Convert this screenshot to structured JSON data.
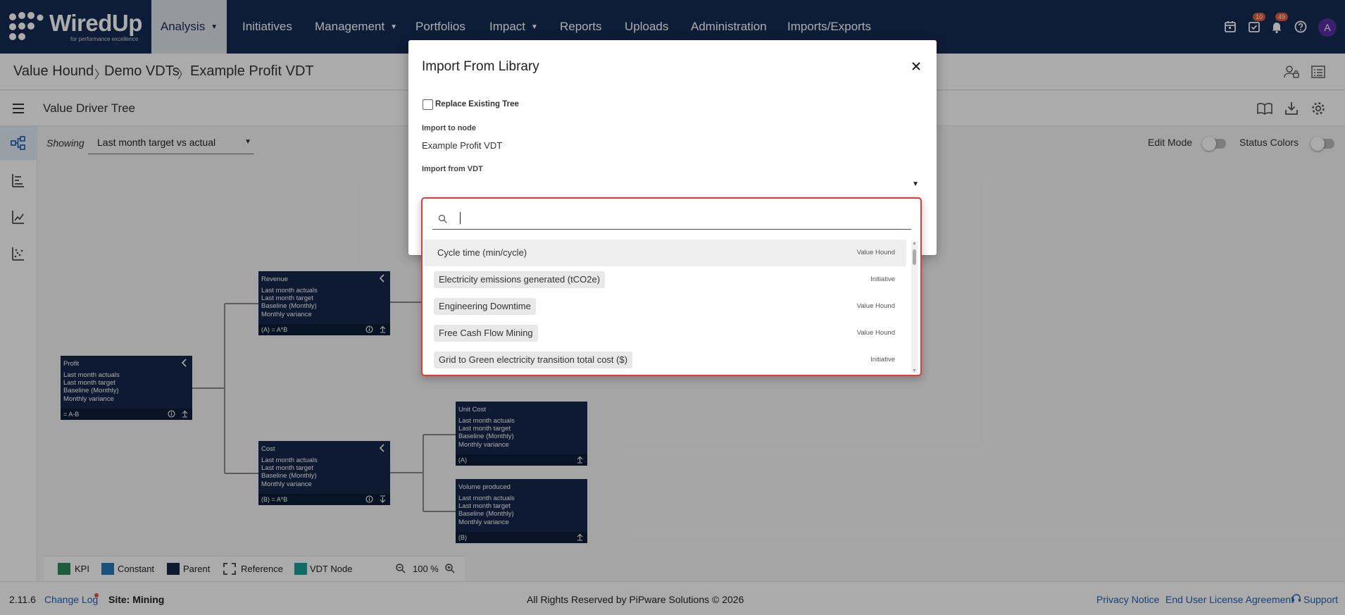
{
  "nav": {
    "logo_text": "WiredUp",
    "logo_tagline": "for performance excellence",
    "items": [
      {
        "label": "Analysis",
        "caret": true,
        "active": true
      },
      {
        "label": "Initiatives",
        "caret": false
      },
      {
        "label": "Management",
        "caret": true
      },
      {
        "label": "Portfolios",
        "caret": false
      },
      {
        "label": "Impact",
        "caret": true
      },
      {
        "label": "Reports",
        "caret": false
      },
      {
        "label": "Uploads",
        "caret": false
      },
      {
        "label": "Administration",
        "caret": false
      },
      {
        "label": "Imports/Exports",
        "caret": false
      }
    ],
    "tasks_badge": "10",
    "notifications_badge": "49",
    "avatar_letter": "A"
  },
  "breadcrumb": [
    "Value Hound",
    "Demo VDTs",
    "Example Profit VDT"
  ],
  "vdt_bar": {
    "title": "Value Driver Tree"
  },
  "toolbar": {
    "showing_label": "Showing",
    "showing_value": "Last month target vs actual",
    "edit_mode_label": "Edit Mode",
    "status_colors_label": "Status Colors"
  },
  "nodes": {
    "profit": {
      "title": "Profit",
      "lines": [
        "Last month actuals",
        "Last month target",
        "Baseline (Monthly)",
        "Monthly variance"
      ],
      "formula": "= A-B"
    },
    "revenue": {
      "title": "Revenue",
      "lines": [
        "Last month actuals",
        "Last month target",
        "Baseline (Monthly)",
        "Monthly variance"
      ],
      "formula": "(A) = A*B"
    },
    "cost": {
      "title": "Cost",
      "lines": [
        "Last month actuals",
        "Last month target",
        "Baseline (Monthly)",
        "Monthly variance"
      ],
      "formula": "(B) = A*B"
    },
    "unit_cost": {
      "title": "Unit Cost",
      "lines": [
        "Last month actuals",
        "Last month target",
        "Baseline (Monthly)",
        "Monthly variance"
      ],
      "formula": "(A)"
    },
    "volume": {
      "title": "Volume produced",
      "lines": [
        "Last month actuals",
        "Last month target",
        "Baseline (Monthly)",
        "Monthly variance"
      ],
      "formula": "(B)"
    }
  },
  "legend": {
    "items": [
      {
        "label": "KPI",
        "color": "#2e8b57"
      },
      {
        "label": "Constant",
        "color": "#2a7ab8"
      },
      {
        "label": "Parent",
        "color": "#14284a"
      },
      {
        "label": "Reference",
        "color": "#ffffff"
      },
      {
        "label": "VDT Node",
        "color": "#1f9e9a"
      }
    ],
    "zoom": "100 %"
  },
  "footer": {
    "version": "2.11.6",
    "changelog": "Change Log",
    "site": "Site: Mining",
    "copyright": "All Rights Reserved by PiPware Solutions © 2026",
    "privacy": "Privacy Notice",
    "eula": "End User License Agreement",
    "support": "Support"
  },
  "modal": {
    "title": "Import From Library",
    "replace_label": "Replace Existing Tree",
    "import_to_label": "Import to node",
    "import_to_value": "Example Profit VDT",
    "import_from_label": "Import from VDT",
    "search_value": ""
  },
  "options": [
    {
      "name": "Cycle time (min/cycle)",
      "source": "Value Hound",
      "highlighted": true
    },
    {
      "name": "Electricity emissions generated (tCO2e)",
      "source": "Initiative"
    },
    {
      "name": "Engineering Downtime",
      "source": "Value Hound"
    },
    {
      "name": "Free Cash Flow Mining",
      "source": "Value Hound"
    },
    {
      "name": "Grid to Green electricity transition total cost ($)",
      "source": "Initiative"
    }
  ],
  "colors": {
    "nav_bg": "#152c52",
    "node_bg": "#14284a",
    "accent_red": "#e53935",
    "link_blue": "#1e63b5"
  }
}
